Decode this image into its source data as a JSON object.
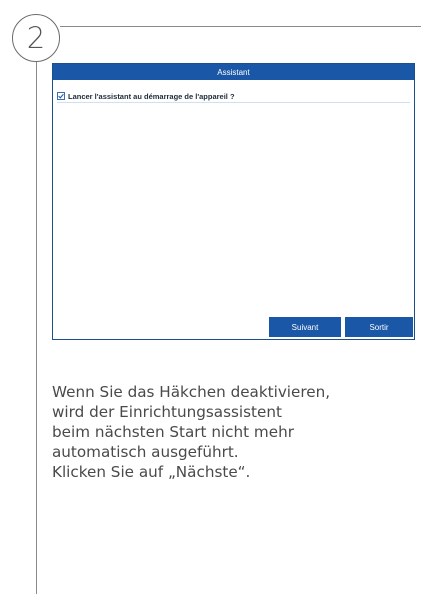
{
  "step": {
    "number": "2"
  },
  "dialog": {
    "title": "Assistant",
    "option": {
      "label": "Lancer l'assistant au démarrage de l'appareil ?",
      "checked": true
    },
    "buttons": {
      "next": "Suivant",
      "exit": "Sortir"
    }
  },
  "description": {
    "lines": [
      "Wenn Sie das Häkchen deaktivieren,",
      "wird der Einrichtungsassistent",
      "beim nächsten Start nicht mehr",
      "automatisch ausgeführt.",
      "Klicken Sie auf „Nächste“."
    ]
  },
  "colors": {
    "accent": "#1a57a6",
    "text": "#4a4a4a",
    "guide": "#8a8a8a"
  }
}
